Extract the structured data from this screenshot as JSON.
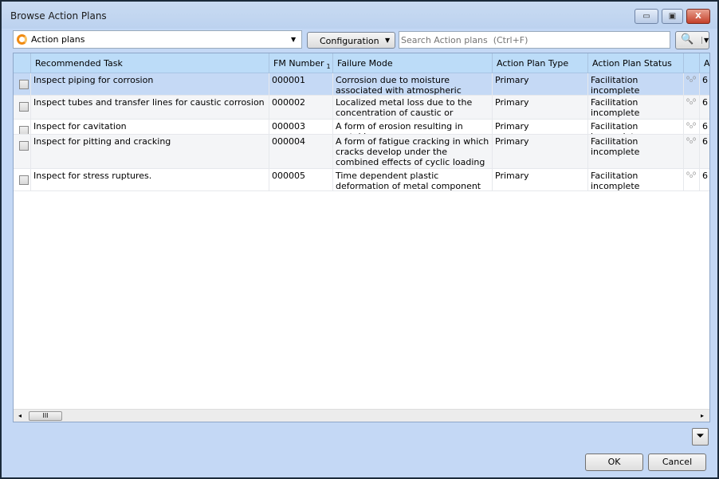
{
  "window": {
    "title": "Browse Action Plans",
    "minimize": "▭",
    "maximize": "▣",
    "close": "X"
  },
  "toolbar": {
    "selector_value": "Action plans",
    "configuration_label": "Configuration",
    "search_placeholder": "Search Action plans  (Ctrl+F)"
  },
  "grid": {
    "columns": [
      "Recommended Task",
      "FM Number",
      "Failure Mode",
      "Action Plan Type",
      "Action Plan Status",
      "",
      "A"
    ],
    "sort_indicator": "1",
    "rows": [
      {
        "task": "Inspect piping for corrosion",
        "fm": "000001",
        "failure": "Corrosion due to moisture associated with atmospheric conditions",
        "type": "Primary",
        "status": "Facilitation incomplete",
        "extra": "6"
      },
      {
        "task": "Inspect tubes and transfer lines for caustic corrosion",
        "fm": "000002",
        "failure": "Localized metal loss due to the concentration of caustic or alkaline salts",
        "type": "Primary",
        "status": "Facilitation incomplete",
        "extra": "6"
      },
      {
        "task": "Inspect for cavitation",
        "fm": "000003",
        "failure": "A form of erosion resulting in metal loss",
        "type": "Primary",
        "status": "Facilitation incomplete",
        "extra": "6"
      },
      {
        "task": "Inspect for pitting and cracking",
        "fm": "000004",
        "failure": "A form of fatigue cracking in which cracks develop under the combined effects of cyclic loading and corrosion",
        "type": "Primary",
        "status": "Facilitation incomplete",
        "extra": "6"
      },
      {
        "task": "Inspect for stress ruptures.",
        "fm": "000005",
        "failure": "Time dependent plastic deformation of metal component",
        "type": "Primary",
        "status": "Facilitation incomplete",
        "extra": "6"
      }
    ]
  },
  "footer": {
    "ok": "OK",
    "cancel": "Cancel"
  }
}
